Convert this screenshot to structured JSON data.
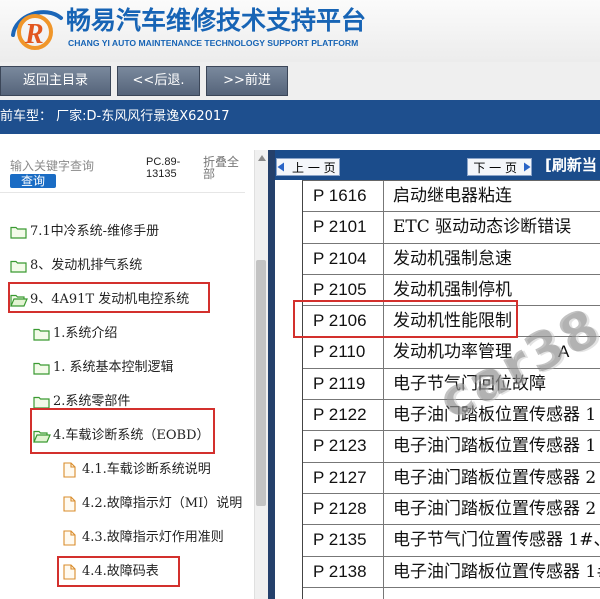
{
  "header": {
    "logo_letter": "R",
    "title": "畅易汽车维修技术支持平台",
    "subtitle": "CHANG YI AUTO MAINTENANCE TECHNOLOGY SUPPORT PLATFORM"
  },
  "toolbar": {
    "home_label": "返回主目录",
    "back_label": "<<后退.",
    "forward_label": ">>前进"
  },
  "vehicle_bar": {
    "text": "前车型： 厂家:D-东风风行景逸X62017"
  },
  "sidebar": {
    "search_placeholder": "输入关键字查询",
    "search_button": "查询",
    "code_line1": "PC.89-",
    "code_line2": "13135",
    "collapse_label": "折叠全部",
    "items": [
      {
        "label": "7.1中冷系统-维修手册",
        "icon": "folder-icon"
      },
      {
        "label": "8、发动机排气系统",
        "icon": "folder-icon"
      },
      {
        "label": "9、4A91T 发动机电控系统",
        "icon": "folder-open-icon"
      },
      {
        "label": "1.系统介绍",
        "icon": "folder-icon"
      },
      {
        "label": "1. 系统基本控制逻辑",
        "icon": "folder-icon"
      },
      {
        "label": "2.系统零部件",
        "icon": "folder-icon"
      },
      {
        "label": "4.车载诊断系统（EOBD）",
        "icon": "folder-open-icon"
      },
      {
        "label": "4.1.车载诊断系统说明",
        "icon": "file-icon"
      },
      {
        "label": "4.2.故障指示灯（MI）说明",
        "icon": "file-icon"
      },
      {
        "label": "4.3.故障指示灯作用准则",
        "icon": "file-icon"
      },
      {
        "label": "4.4.故障码表",
        "icon": "file-icon"
      }
    ]
  },
  "pager": {
    "prev_label": "上 一 页",
    "next_label": "下 一 页",
    "refresh_label": "[刷新当"
  },
  "codes": [
    {
      "code": "P 1616",
      "desc": "启动继电器粘连"
    },
    {
      "code": "P 2101",
      "desc": "ETC 驱动动态诊断错误"
    },
    {
      "code": "P 2104",
      "desc": "发动机强制怠速"
    },
    {
      "code": "P 2105",
      "desc": "发动机强制停机"
    },
    {
      "code": "P 2106",
      "desc": "发动机性能限制"
    },
    {
      "code": "P 2110",
      "desc": "发动机功率管理",
      "suffix": "A"
    },
    {
      "code": "P 2119",
      "desc": "电子节气门回位故障"
    },
    {
      "code": "P 2122",
      "desc": "电子油门踏板位置传感器 1"
    },
    {
      "code": "P 2123",
      "desc": "电子油门踏板位置传感器 1"
    },
    {
      "code": "P 2127",
      "desc": "电子油门踏板位置传感器 2"
    },
    {
      "code": "P 2128",
      "desc": "电子油门踏板位置传感器 2"
    },
    {
      "code": "P 2135",
      "desc": "电子节气门位置传感器 1#、"
    },
    {
      "code": "P 2138",
      "desc": "电子油门踏板位置传感器 1#、"
    }
  ],
  "watermark": "car38",
  "colors": {
    "brand_blue": "#1764b5",
    "nav_blue": "#1e4f8e",
    "button_gray": "#5f6f86",
    "search_blue": "#1a6cc4",
    "highlight_red": "#d3302d",
    "folder_green": "#3a9a32",
    "file_orange": "#d98c2b"
  }
}
